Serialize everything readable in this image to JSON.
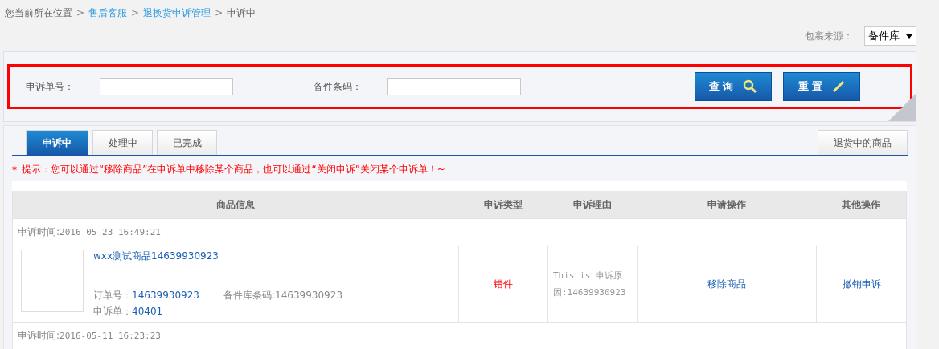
{
  "breadcrumb": {
    "prefix": "您当前所在位置",
    "separator": ">",
    "items": [
      {
        "label": "售后客服",
        "link": true
      },
      {
        "label": "退换货申诉管理",
        "link": true
      },
      {
        "label": "申诉中",
        "link": false
      }
    ]
  },
  "source": {
    "label": "包裹来源：",
    "value": "备件库"
  },
  "search": {
    "fields": [
      {
        "label": "申诉单号："
      },
      {
        "label": "备件条码："
      }
    ],
    "buttons": [
      {
        "label": "查 询",
        "kind": "search"
      },
      {
        "label": "重 置",
        "kind": "edit"
      }
    ]
  },
  "tabs": [
    {
      "label": "申诉中",
      "selected": true
    },
    {
      "label": "处理中",
      "selected": false
    },
    {
      "label": "已完成",
      "selected": false
    }
  ],
  "side_tab": "退货中的商品",
  "hint": {
    "mark": "*",
    "text": "提示：您可以通过“移除商品”在申诉单中移除某个商品，也可以通过“关闭申诉”关闭某个申诉单！~"
  },
  "table": {
    "columns": [
      "商品信息",
      "申诉类型",
      "申诉理由",
      "申请操作",
      "其他操作"
    ],
    "groups": [
      {
        "time_label": "申诉时间:",
        "time": "2016-05-23 16:49:21",
        "items": [
          {
            "name": "wxx测试商品14639930923",
            "order_label": "订单号：",
            "order": "14639930923",
            "barcode_label": "备件库条码:",
            "barcode": "14639930923",
            "appeal_label": "申诉单：",
            "appeal": "40401",
            "type": "错件",
            "reason": "This is 申诉原因:14639930923",
            "action": "移除商品",
            "other": "撤销申诉"
          }
        ]
      },
      {
        "time_label": "申诉时间:",
        "time": "2016-05-11 16:23:23"
      }
    ]
  }
}
